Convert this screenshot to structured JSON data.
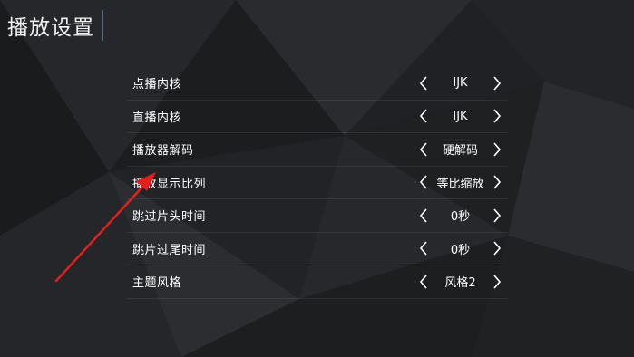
{
  "page": {
    "title": "播放设置"
  },
  "settings": [
    {
      "label": "点播内核",
      "value": "IJK"
    },
    {
      "label": "直播内核",
      "value": "IJK"
    },
    {
      "label": "播放器解码",
      "value": "硬解码"
    },
    {
      "label": "播放显示比列",
      "value": "等比缩放"
    },
    {
      "label": "跳过片头时间",
      "value": "0秒"
    },
    {
      "label": "跳片过尾时间",
      "value": "0秒"
    },
    {
      "label": "主题风格",
      "value": "风格2"
    }
  ],
  "icons": {
    "prev": "chevron-left-icon",
    "next": "chevron-right-icon"
  },
  "colors": {
    "annotation_arrow": "#e0201e",
    "background": "#1e1f21"
  }
}
